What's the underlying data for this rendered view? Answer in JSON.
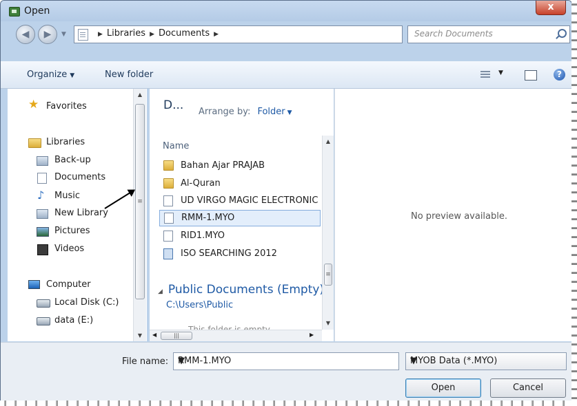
{
  "window": {
    "title": "Open",
    "close": "x"
  },
  "address": {
    "crumbs": [
      "Libraries",
      "Documents"
    ],
    "search_placeholder": "Search Documents"
  },
  "toolbar": {
    "organize": "Organize",
    "new_folder": "New folder"
  },
  "nav": {
    "favorites": "Favorites",
    "libraries": "Libraries",
    "backup": "Back-up",
    "documents": "Documents",
    "music": "Music",
    "new_library": "New Library",
    "pictures": "Pictures",
    "videos": "Videos",
    "computer": "Computer",
    "local_disk": "Local Disk (C:)",
    "data_drive": "data (E:)"
  },
  "filelist": {
    "library_title": "D...",
    "arrange_label": "Arrange by:",
    "arrange_value": "Folder",
    "column_name": "Name",
    "files": [
      {
        "name": "Bahan Ajar PRAJAB",
        "icon": "folder-icon"
      },
      {
        "name": "Al-Quran",
        "icon": "folder-icon"
      },
      {
        "name": "UD VIRGO MAGIC ELECTRONIC",
        "icon": "file-icon"
      },
      {
        "name": "RMM-1.MYO",
        "icon": "file-icon"
      },
      {
        "name": "RID1.MYO",
        "icon": "file-icon"
      },
      {
        "name": "ISO SEARCHING 2012",
        "icon": "iso-file-icon"
      }
    ],
    "section_title": "Public Documents (Empty)",
    "section_path": "C:\\Users\\Public",
    "section_note": "This folder is empty."
  },
  "preview": {
    "text": "No preview available."
  },
  "footer": {
    "file_name_label": "File name:",
    "file_name_value": "RMM-1.MYO",
    "file_type": "MYOB Data (*.MYO)",
    "open": "Open",
    "cancel": "Cancel"
  }
}
